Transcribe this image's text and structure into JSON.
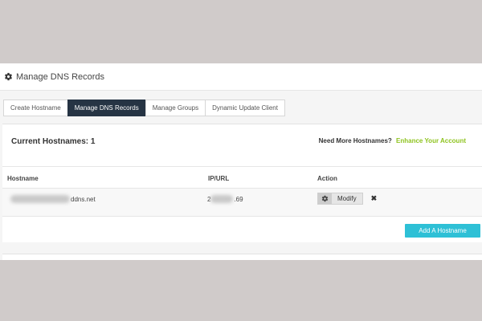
{
  "header": {
    "title": "Manage DNS Records",
    "icon": "gear-icon"
  },
  "tabs": [
    {
      "label": "Create Hostname",
      "active": false
    },
    {
      "label": "Manage DNS Records",
      "active": true
    },
    {
      "label": "Manage Groups",
      "active": false
    },
    {
      "label": "Dynamic Update Client",
      "active": false
    }
  ],
  "summary": {
    "title": "Current Hostnames: 1",
    "prompt": "Need More Hostnames?",
    "link": "Enhance Your Account"
  },
  "table": {
    "columns": [
      "Hostname",
      "IP/URL",
      "Action"
    ],
    "rows": [
      {
        "hostname_suffix": "ddns.net",
        "ip_prefix": "2",
        "ip_suffix": ".69",
        "modify_label": "Modify",
        "remove_icon": "close-icon"
      }
    ]
  },
  "actions": {
    "add_label": "Add A Hostname"
  },
  "colors": {
    "active_tab": "#263444",
    "accent_link": "#8ec31f",
    "add_button": "#2ec0d6",
    "background": "#d0cbca"
  }
}
